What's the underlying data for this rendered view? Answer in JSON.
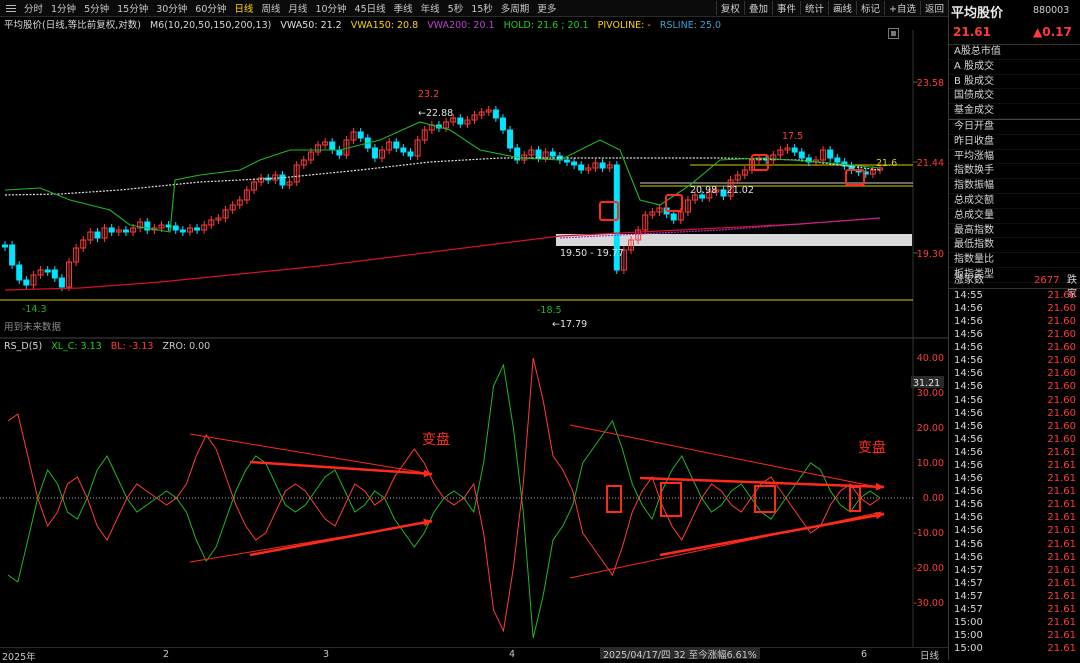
{
  "toolbar": {
    "periods": [
      "分时",
      "1分钟",
      "5分钟",
      "15分钟",
      "30分钟",
      "60分钟",
      "日线",
      "周线",
      "月线",
      "10分钟",
      "45日线",
      "季线",
      "年线",
      "5秒",
      "15秒",
      "多周期",
      "更多"
    ],
    "active_period": "日线",
    "tools": [
      "复权",
      "叠加",
      "事件",
      "统计",
      "画线",
      "标记",
      "+自选",
      "返回"
    ]
  },
  "legend": {
    "name": "平均股价(日线,等比前复权,对数)",
    "ma": "M6(10,20,50,150,200,13)",
    "vwa50": "VWA50: 21.2",
    "vwa150": "VWA150: 20.8",
    "vwa200": "VWA200: 20.1",
    "hold": "HOLD: 21.6 ; 20.1",
    "pivoline": "PIVOLINE: -",
    "rsline": "RSLINE: 25.0"
  },
  "main_annotations": {
    "high_label": "23.2",
    "high_arrow": "22.88",
    "low_label": "-18.5",
    "low_arrow": "17.79",
    "left_low": "-14.3",
    "pivot_label": "17.5",
    "right_label": "21.6",
    "zone1": "19.50 - 19.77",
    "zone2": "20.98 - 21.02",
    "no_future": "用到未来数据"
  },
  "price_axis": [
    "23.58",
    "21.44",
    "19.30"
  ],
  "indicator": {
    "name": "RS_D(5)",
    "xlc": "XL_C: 3.13",
    "bl": "BL: -3.13",
    "zro": "ZRO: 0.00",
    "axis": [
      "40.00",
      "30.00",
      "20.00",
      "10.00",
      "0.00",
      "-10.00",
      "-20.00",
      "-30.00"
    ],
    "current": "31.21",
    "annotation": "变盘"
  },
  "xaxis": {
    "labels": [
      "2025年",
      "2",
      "3",
      "4",
      "6"
    ],
    "status": "2025/04/17/四 32 至今涨幅6.61%",
    "period": "日线"
  },
  "right_panel": {
    "title": "平均股价",
    "code": "880003",
    "price": "21.61",
    "change": "▲0.17",
    "rows": [
      "A股总市值",
      "A 股成交",
      "B 股成交",
      "国债成交",
      "基金成交",
      "今日开盘",
      "昨日收盘",
      "平均涨幅",
      "指数换手",
      "指数振幅",
      "总成交额",
      "总成交量",
      "最高指数",
      "最低指数",
      "指数量比",
      "板指类型"
    ],
    "up_count_label": "涨家数",
    "up_count": "2677",
    "down_label": "跌家",
    "ticks": [
      {
        "t": "14:55",
        "p": "21.60"
      },
      {
        "t": "14:56",
        "p": "21.60"
      },
      {
        "t": "14:56",
        "p": "21.60"
      },
      {
        "t": "14:56",
        "p": "21.60"
      },
      {
        "t": "14:56",
        "p": "21.60"
      },
      {
        "t": "14:56",
        "p": "21.60"
      },
      {
        "t": "14:56",
        "p": "21.60"
      },
      {
        "t": "14:56",
        "p": "21.60"
      },
      {
        "t": "14:56",
        "p": "21.60"
      },
      {
        "t": "14:56",
        "p": "21.60"
      },
      {
        "t": "14:56",
        "p": "21.60"
      },
      {
        "t": "14:56",
        "p": "21.60"
      },
      {
        "t": "14:56",
        "p": "21.61"
      },
      {
        "t": "14:56",
        "p": "21.61"
      },
      {
        "t": "14:56",
        "p": "21.61"
      },
      {
        "t": "14:56",
        "p": "21.61"
      },
      {
        "t": "14:56",
        "p": "21.61"
      },
      {
        "t": "14:56",
        "p": "21.61"
      },
      {
        "t": "14:56",
        "p": "21.61"
      },
      {
        "t": "14:56",
        "p": "21.61"
      },
      {
        "t": "14:56",
        "p": "21.61"
      },
      {
        "t": "14:57",
        "p": "21.61"
      },
      {
        "t": "14:57",
        "p": "21.61"
      },
      {
        "t": "14:57",
        "p": "21.61"
      },
      {
        "t": "14:57",
        "p": "21.61"
      },
      {
        "t": "15:00",
        "p": "21.61"
      },
      {
        "t": "15:00",
        "p": "21.61"
      },
      {
        "t": "15:00",
        "p": "21.61"
      }
    ]
  },
  "colors": {
    "up": "#ff3b3b",
    "down": "#00e5ff",
    "ma_green": "#1fb81f",
    "vwa": "#e0e0e0",
    "ma_red": "#d4102a",
    "ma_purple": "#b030c0",
    "yellow": "#d8d000",
    "annotation": "#ff2a1a"
  }
}
